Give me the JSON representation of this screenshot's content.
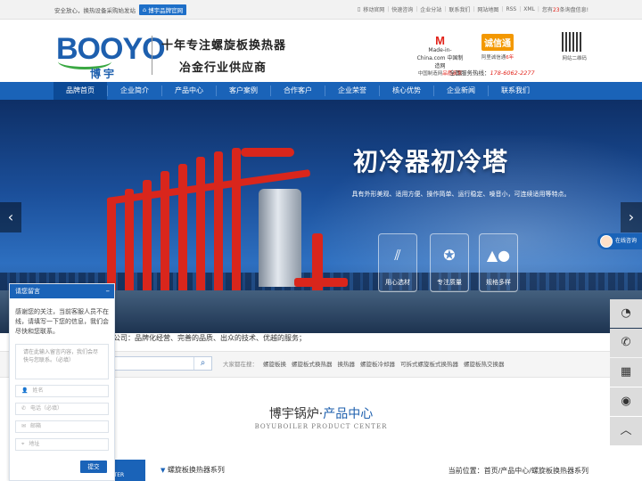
{
  "topbar": {
    "welcome": "安全放心，换热设备采购始发站",
    "brand_badge": "博宇品牌官网",
    "links": [
      "移动官网",
      "快速咨询",
      "企业分站",
      "联系我们",
      "网站地图",
      "RSS",
      "XML"
    ],
    "notice_prefix": "您有",
    "notice_count": "23",
    "notice_suffix": "条询盘信息!"
  },
  "header": {
    "logo_text": "BOOYO",
    "logo_sub": "博宇",
    "slogan_line1": "十年专注螺旋板换热器",
    "slogan_line2": "冶金行业供应商",
    "mic_mark": "M",
    "mic_name": "Made-in-China.com 中国制造网",
    "mic_tag_prefix": "中国制造网",
    "mic_tag_red": "品质商家",
    "cxt_badge": "诚信通",
    "cxt_tag_prefix": "阿里诚信通",
    "cxt_tag_red": "6年",
    "qr_label": "网站二维码",
    "hotline_label": "全国服务热线：",
    "hotline_number": "178-6062-2277"
  },
  "nav": [
    "品牌首页",
    "企业简介",
    "产品中心",
    "客户案例",
    "合作客户",
    "企业荣誉",
    "核心优势",
    "企业新闻",
    "联系我们"
  ],
  "banner": {
    "title": "初冷器初冷塔",
    "desc": "具有外形美观、适用方便、操作简单、运行稳定、噪音小，可连续适用等特点。",
    "features": [
      "用心选材",
      "专注质量",
      "规格多样"
    ]
  },
  "marquee": "公司：品牌化经营、完善的品质、出众的技术、优越的服务；",
  "search": {
    "hot_label": "大家都在搜：",
    "keywords": [
      "螺旋板换",
      "螺旋板式换热器",
      "换热器",
      "螺旋板冷却器",
      "可拆式螺旋板式换热器",
      "螺旋板热交换器"
    ]
  },
  "product_center": {
    "title_left": "博宇锅炉·",
    "title_right": "产品中心",
    "subtitle": "BOYUBOILER PRODUCT CENTER",
    "tab_label": "PRODUCT CENTER",
    "category": "螺旋板换热器系列",
    "crumb": "当前位置：首页/产品中心/螺旋板换热器系列"
  },
  "chat": {
    "header": "请您留言",
    "message": "感谢您的关注，当前客服人员不在线，请填写一下您的信息，我们会尽快和您联系。",
    "textarea_placeholder": "请在此输入留言内容，我们会尽快与您联系。（必填）",
    "fields": [
      "姓名",
      "电话（必填）",
      "邮箱",
      "地址"
    ],
    "submit": "提交"
  },
  "chat_tab": "在线咨询",
  "colors": {
    "primary": "#1a63b8",
    "accent_red": "#e2231a",
    "orange": "#f39800"
  }
}
